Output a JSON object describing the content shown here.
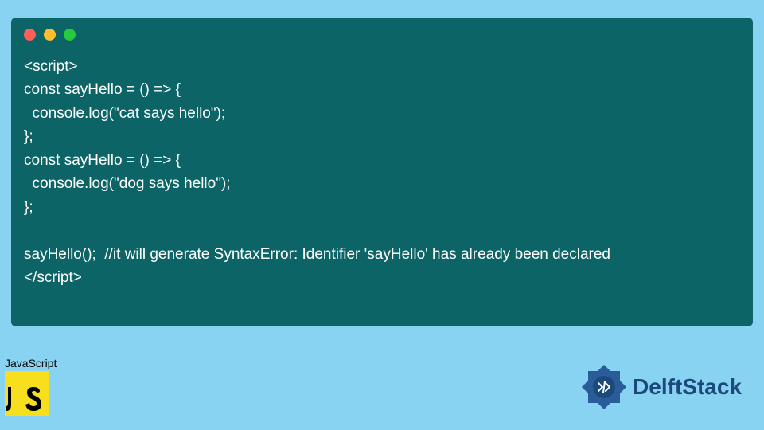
{
  "code": {
    "lines": [
      "<script>",
      "const sayHello = () => {",
      "  console.log(\"cat says hello\");",
      "};",
      "const sayHello = () => {",
      "  console.log(\"dog says hello\");",
      "};",
      "",
      "sayHello();  //it will generate SyntaxError: Identifier 'sayHello' has already been declared",
      "</script>"
    ]
  },
  "badge": {
    "label": "JavaScript",
    "logo_text": "JS"
  },
  "brand": {
    "name": "DelftStack"
  },
  "colors": {
    "background": "#88d2f2",
    "code_bg": "#0d6467",
    "code_text": "#ffffff",
    "js_yellow": "#f7df1e",
    "brand_blue": "#1b4a7a"
  }
}
